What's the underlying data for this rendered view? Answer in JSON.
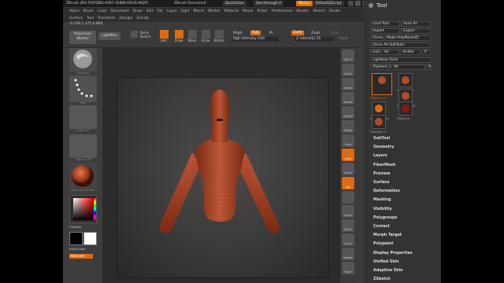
{
  "title": {
    "app": "ZBrush 4R4 P2[PQBG-AYKF-QHBN-DSHS-NGJP]",
    "document": "ZBrush Document",
    "quicksave": "QuickSave",
    "see_through": "See-through  0",
    "menus_btn": "Menus",
    "script": "DefaultZScript"
  },
  "menus": {
    "row1": [
      "Alpha",
      "Brush",
      "Color",
      "Document",
      "Draw",
      "Edit",
      "File",
      "Layer",
      "Light",
      "Macro",
      "Marker",
      "Material",
      "Movie",
      "Picker",
      "Preferences",
      "Render",
      "Stencil",
      "Stroke"
    ],
    "row2": [
      "Surface",
      "Tool",
      "Transform",
      "Zplugin",
      "Zscript"
    ]
  },
  "coords": "0.378,1.375,0.864",
  "toolbar": {
    "projection_master": "Projection Master",
    "lightbox": "LightBox",
    "quick_sketch": "Quick Sketch",
    "edit": "Edit",
    "draw": "Draw",
    "move": "Move",
    "scale": "Scale",
    "rotate": "Rotate",
    "mrgb": "Mrgb",
    "rgb": "Rgb",
    "m": "M",
    "zadd": "Zadd",
    "zsub": "Zsub",
    "zcut": "Zcut",
    "rgb_intensity": "Rgb Intensity 100",
    "z_intensity": "Z Intensity 25",
    "focal_shift": "Focal"
  },
  "leftshelf": {
    "standard": "Standard",
    "dots": "Dots",
    "alpha_off": "Alpha Off",
    "texture_off": "Texture Off",
    "material": "MatCap Red Wax",
    "gradient": "Gradient",
    "switch_color": "SwitchColor",
    "alternate": "Alternate"
  },
  "rightshelf": [
    {
      "label": "SPix 3"
    },
    {
      "label": "Scroll"
    },
    {
      "label": "Zoom"
    },
    {
      "label": "Actual"
    },
    {
      "label": "AAHalf"
    },
    {
      "label": "Persp"
    },
    {
      "label": "Floor"
    },
    {
      "label": "Local"
    },
    {
      "label": "L.Sym"
    },
    {
      "label": "Xyz"
    },
    {
      "label": ""
    },
    {
      "label": "Frame"
    },
    {
      "label": "Move"
    },
    {
      "label": "Scale"
    },
    {
      "label": "Rotate"
    },
    {
      "label": "PolyF"
    }
  ],
  "palette": {
    "title": "Tool",
    "load_tool": "Load Tool",
    "save_as": "Save As",
    "import": "Import",
    "export": "Export",
    "clone": "Clone",
    "make_polymesh": "Make PolyMesh3D",
    "clone_all": "Clone All SubTools",
    "goz": "GoZ",
    "all": "All",
    "visible": "Visible",
    "r": "R",
    "lightbox_tools": "Lightbox›Tools",
    "current_tool": "ZSphere_1. 46",
    "thumbs": [
      "ZSphere_1",
      "Cylinder3D",
      "PolyMesh3D",
      "SimpleBrush",
      "ZSphere",
      "ZSphere_1"
    ],
    "subpalettes": [
      "SubTool",
      "Geometry",
      "Layers",
      "FiberMesh",
      "Preview",
      "Surface",
      "Deformation",
      "Masking",
      "Visibility",
      "Polygroups",
      "Contact",
      "Morph Target",
      "Polypaint",
      "Display Properties",
      "Unified Skin",
      "Adaptive Skin",
      "ZSketch"
    ]
  },
  "colors": {
    "accent": "#e06a10",
    "model": "#b34a2c"
  }
}
